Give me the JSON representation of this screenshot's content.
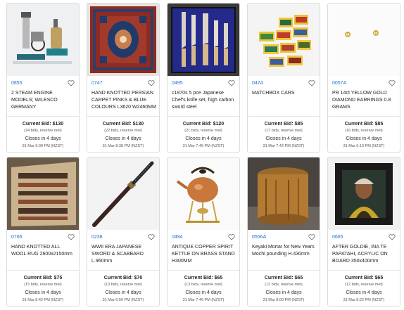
{
  "lots": [
    {
      "lot": "0855",
      "title": "2 STEAM ENGINE MODELS; WILESCO GERMANY",
      "bid": "Current Bid: $130",
      "bids": "(24 bids, reserve met)",
      "closes": "Closes in 4 days",
      "date": "31 Mar 9:00 PM (NZST)",
      "image": "steam-engine-models"
    },
    {
      "lot": "0747",
      "title": "HAND KNOTTED PERSIAN CARPET PINKS & BLUE COLOURS L3620 W2460MM",
      "bid": "Current Bid: $130",
      "bids": "(22 bids, reserve met)",
      "closes": "Closes in 4 days",
      "date": "31 Mar 8:38 PM (NZST)",
      "image": "persian-carpet"
    },
    {
      "lot": "0495",
      "title": "c1970s 5 pce Japanese Chef's knife set, high carbon sword steel",
      "bid": "Current Bid: $120",
      "bids": "(21 bids, reserve met)",
      "closes": "Closes in 4 days",
      "date": "31 Mar 7:46 PM (NZST)",
      "image": "knife-set"
    },
    {
      "lot": "0474",
      "title": "MATCHBOX CARS",
      "bid": "Current Bid: $85",
      "bids": "(17 bids, reserve met)",
      "closes": "Closes in 4 days",
      "date": "31 Mar 7:42 PM (NZST)",
      "image": "matchbox-cars"
    },
    {
      "lot": "0057A",
      "title": "PR 14ct YELLOW GOLD DIAMOND EARRINGS 0.8 GRAMS",
      "bid": "Current Bid: $85",
      "bids": "(16 bids, reserve met)",
      "closes": "Closes in 4 days",
      "date": "31 Mar 6:10 PM (NZST)",
      "image": "diamond-earrings"
    },
    {
      "lot": "0766",
      "title": "HAND KNOTTED ALL WOOL RUG 2600x2150mm",
      "bid": "Current Bid: $75",
      "bids": "(15 bids, reserve met)",
      "closes": "Closes in 4 days",
      "date": "31 Mar 8:42 PM (NZST)",
      "image": "wool-rug"
    },
    {
      "lot": "0238",
      "title": "WWII ERA JAPANESE SWORD & SCABBARD L.960mm",
      "bid": "Current Bid: $70",
      "bids": "(13 bids, reserve met)",
      "closes": "Closes in 4 days",
      "date": "31 Mar 6:50 PM (NZST)",
      "image": "japanese-sword"
    },
    {
      "lot": "0494",
      "title": "ANTIQUE COPPER SPIRIT KETTLE ON BRASS STAND H300MM",
      "bid": "Current Bid: $65",
      "bids": "(13 bids, reserve met)",
      "closes": "Closes in 4 days",
      "date": "31 Mar 7:46 PM (NZST)",
      "image": "copper-kettle"
    },
    {
      "lot": "0556A",
      "title": "Keyaki Mortar for New Years Mochi pounding H.430mm",
      "bid": "Current Bid: $65",
      "bids": "(12 bids, reserve met)",
      "closes": "Closes in 4 days",
      "date": "31 Mar 8:00 PM (NZST)",
      "image": "mochi-mortar"
    },
    {
      "lot": "0665",
      "title": "AFTER GOLDIE, INA TE PAPATAHI, ACRYLIC ON BOARD 350x400mm",
      "bid": "Current Bid: $65",
      "bids": "(12 bids, reserve met)",
      "closes": "Closes in 4 days",
      "date": "31 Mar 8:22 PM (NZST)",
      "image": "portrait-painting"
    }
  ],
  "colors": {
    "lot_link": "#1f6fd1",
    "border": "#dcdcdc"
  },
  "icons": {
    "watch": "heart-icon"
  }
}
